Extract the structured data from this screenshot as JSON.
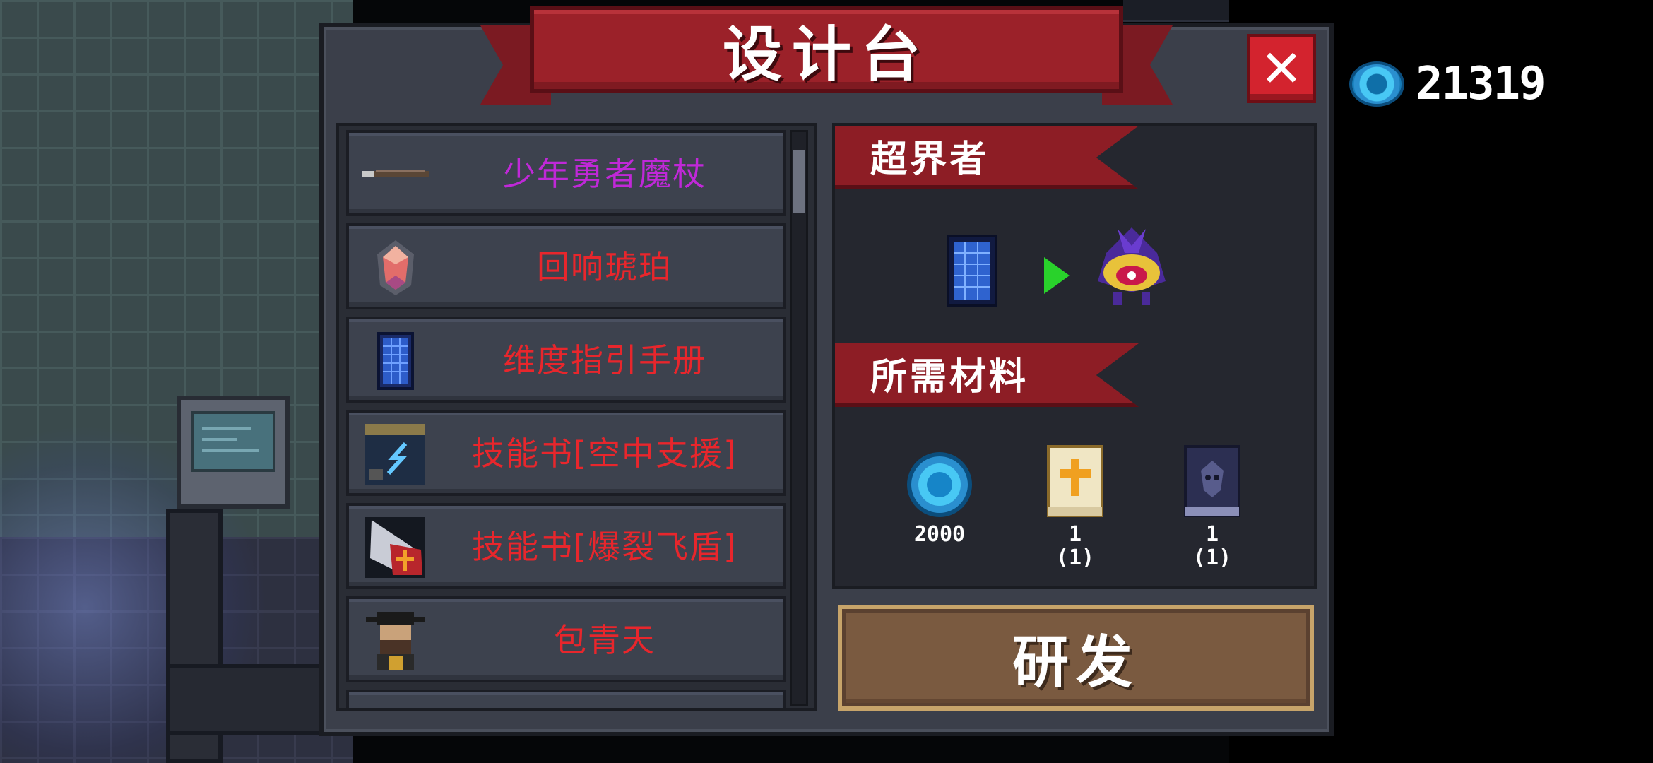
{
  "header": {
    "title": "设计台"
  },
  "currency": {
    "icon": "blue-gem-icon",
    "value": "21319"
  },
  "close_button": {
    "label": "✕"
  },
  "list": {
    "items": [
      {
        "label": "少年勇者魔杖",
        "color": "#c028d8",
        "icon": "wand-icon"
      },
      {
        "label": "回响琥珀",
        "color": "#e8262c",
        "icon": "amber-gem-icon"
      },
      {
        "label": "维度指引手册",
        "color": "#e8262c",
        "icon": "dimension-manual-icon"
      },
      {
        "label": "技能书[空中支援]",
        "color": "#e8262c",
        "icon": "skill-book-air-support-icon"
      },
      {
        "label": "技能书[爆裂飞盾]",
        "color": "#e8262c",
        "icon": "skill-book-burst-shield-icon"
      },
      {
        "label": "包青天",
        "color": "#e8262c",
        "icon": "judge-character-icon"
      }
    ]
  },
  "detail": {
    "result_title": "超界者",
    "from_icon": "dimension-manual-icon",
    "to_icon": "purple-wizard-pet-icon",
    "materials_title": "所需材料",
    "materials": [
      {
        "icon": "blue-gem-icon",
        "count": "2000"
      },
      {
        "icon": "holy-book-icon",
        "count": "1\n(1)"
      },
      {
        "icon": "dark-book-icon",
        "count": "1\n(1)"
      }
    ]
  },
  "develop_button": {
    "label": "研发"
  }
}
